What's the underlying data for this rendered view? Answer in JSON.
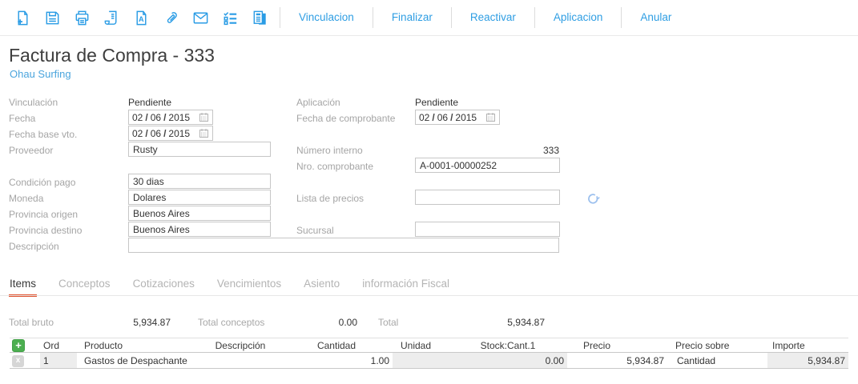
{
  "toolbar": {
    "icons": [
      "new-document",
      "save",
      "print",
      "receipt",
      "document-a",
      "attachment",
      "email",
      "checklist",
      "copy-document"
    ],
    "actions": [
      "Vinculacion",
      "Finalizar",
      "Reactivar",
      "Aplicacion",
      "Anular"
    ]
  },
  "header": {
    "title": "Factura de Compra - 333",
    "subtitle": "Ohau Surfing"
  },
  "form": {
    "date_separator": "/",
    "vinculacion": {
      "label": "Vinculación",
      "value": "Pendiente"
    },
    "aplicacion": {
      "label": "Aplicación",
      "value": "Pendiente"
    },
    "fecha": {
      "label": "Fecha",
      "day": "02",
      "month": "06",
      "year": "2015"
    },
    "fecha_comprobante": {
      "label": "Fecha de comprobante",
      "day": "02",
      "month": "06",
      "year": "2015"
    },
    "fecha_base": {
      "label": "Fecha base vto.",
      "day": "02",
      "month": "06",
      "year": "2015"
    },
    "proveedor": {
      "label": "Proveedor",
      "value": "Rusty"
    },
    "numero_interno": {
      "label": "Número interno",
      "value": "333"
    },
    "nro_comprobante": {
      "label": "Nro. comprobante",
      "value": "A-0001-00000252"
    },
    "condicion_pago": {
      "label": "Condición pago",
      "value": "30 dias"
    },
    "moneda": {
      "label": "Moneda",
      "value": "Dolares"
    },
    "lista_precios": {
      "label": "Lista de precios",
      "value": ""
    },
    "provincia_origen": {
      "label": "Provincia origen",
      "value": "Buenos Aires"
    },
    "provincia_destino": {
      "label": "Provincia destino",
      "value": "Buenos Aires"
    },
    "sucursal": {
      "label": "Sucursal",
      "value": ""
    },
    "descripcion": {
      "label": "Descripción",
      "value": ""
    }
  },
  "tabs": {
    "items": [
      "Items",
      "Conceptos",
      "Cotizaciones",
      "Vencimientos",
      "Asiento",
      "información Fiscal"
    ],
    "active": "Items"
  },
  "totals": [
    {
      "label": "Total bruto",
      "value": "5,934.87"
    },
    {
      "label": "Total conceptos",
      "value": "0.00"
    },
    {
      "label": "Total",
      "value": "5,934.87"
    }
  ],
  "table": {
    "headers": [
      "Ord",
      "Producto",
      "Descripción",
      "Cantidad",
      "Unidad",
      "Stock:Cant.1",
      "Precio",
      "Precio sobre",
      "Importe"
    ],
    "rows": [
      {
        "ord": "1",
        "producto": "Gastos de Despachante",
        "descripcion": "",
        "cantidad": "1.00",
        "unidad": "",
        "stock_cant": "0.00",
        "precio": "5,934.87",
        "precio_sobre": "Cantidad",
        "importe": "5,934.87"
      }
    ],
    "add_label": "+",
    "delete_label": "x"
  },
  "colors": {
    "accent_blue": "#2f9ee3",
    "link_blue": "#4ba5dd",
    "tab_underline_red": "#e0512d",
    "add_green": "#4caf50",
    "row_gray": "#ededed",
    "label_gray": "#a5a5a5"
  }
}
